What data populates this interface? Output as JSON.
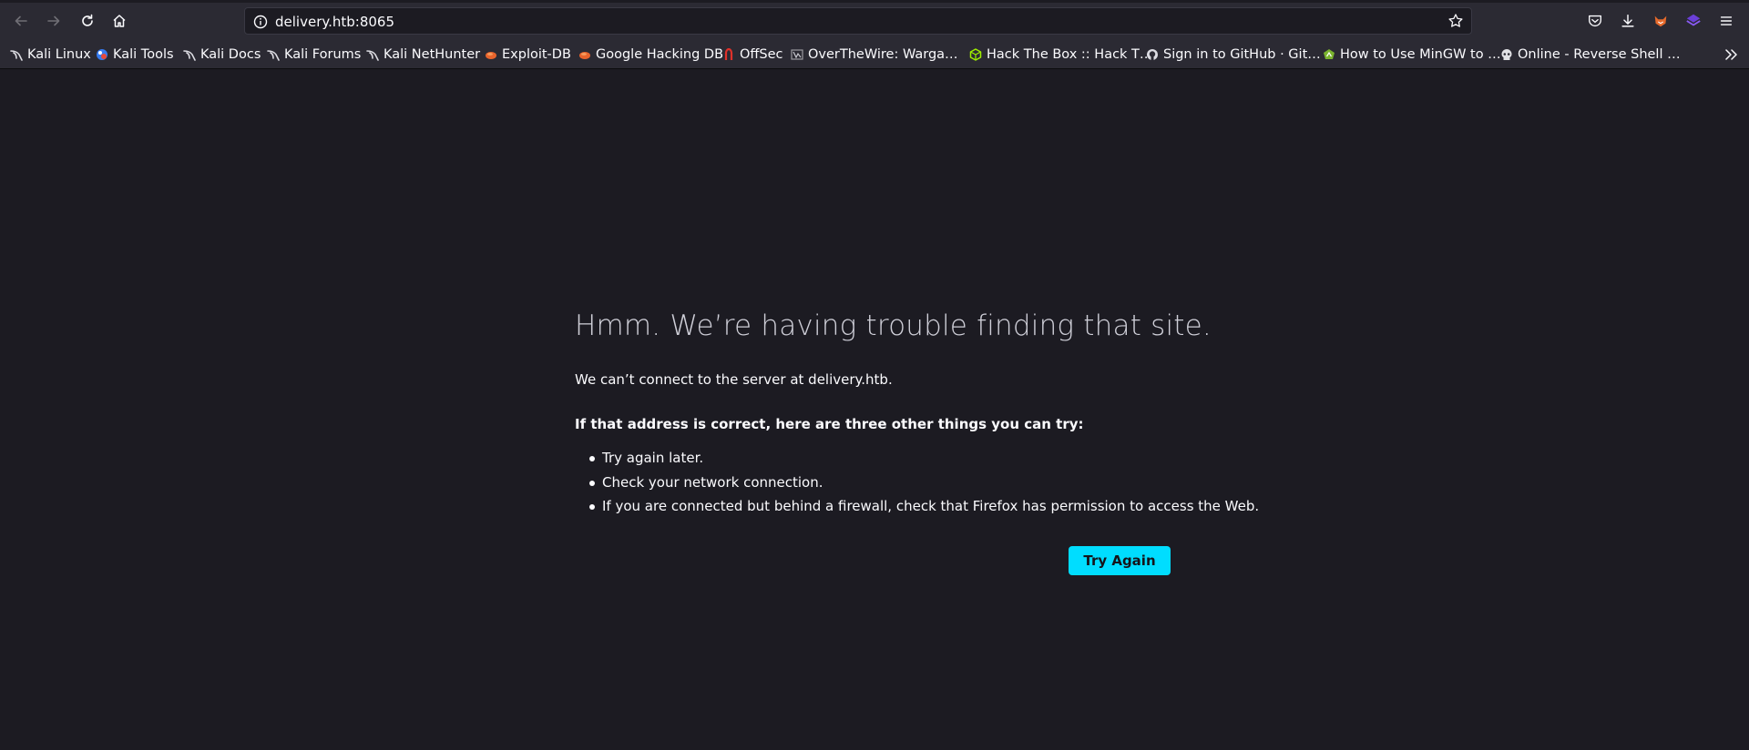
{
  "browser": {
    "url": "delivery.htb:8065",
    "bookmarks": [
      {
        "label": "Kali Linux",
        "icon": "kali-dragon-icon"
      },
      {
        "label": "Kali Tools",
        "icon": "kali-tools-icon"
      },
      {
        "label": "Kali Docs",
        "icon": "kali-dragon-icon"
      },
      {
        "label": "Kali Forums",
        "icon": "kali-dragon-icon"
      },
      {
        "label": "Kali NetHunter",
        "icon": "kali-dragon-icon"
      },
      {
        "label": "Exploit-DB",
        "icon": "exploitdb-icon"
      },
      {
        "label": "Google Hacking DB",
        "icon": "exploitdb-icon"
      },
      {
        "label": "OffSec",
        "icon": "offsec-icon"
      },
      {
        "label": "OverTheWire: Warga…",
        "icon": "overthewire-icon"
      },
      {
        "label": "Hack The Box :: Hack T…",
        "icon": "hackthebox-icon"
      },
      {
        "label": "Sign in to GitHub · Git…",
        "icon": "github-icon"
      },
      {
        "label": "How to Use MinGW to …",
        "icon": "mingw-icon"
      },
      {
        "label": "Online - Reverse Shell …",
        "icon": "skull-icon"
      }
    ]
  },
  "error": {
    "title": "Hmm. We’re having trouble finding that site.",
    "description": "We can’t connect to the server at delivery.htb.",
    "subheading": "If that address is correct, here are three other things you can try:",
    "suggestions": [
      "Try again later.",
      "Check your network connection.",
      "If you are connected but behind a firewall, check that Firefox has permission to access the Web."
    ],
    "button_label": "Try Again"
  },
  "colors": {
    "page_bg": "#1c1b22",
    "toolbar_bg": "#2b2a33",
    "accent": "#00ddff"
  }
}
